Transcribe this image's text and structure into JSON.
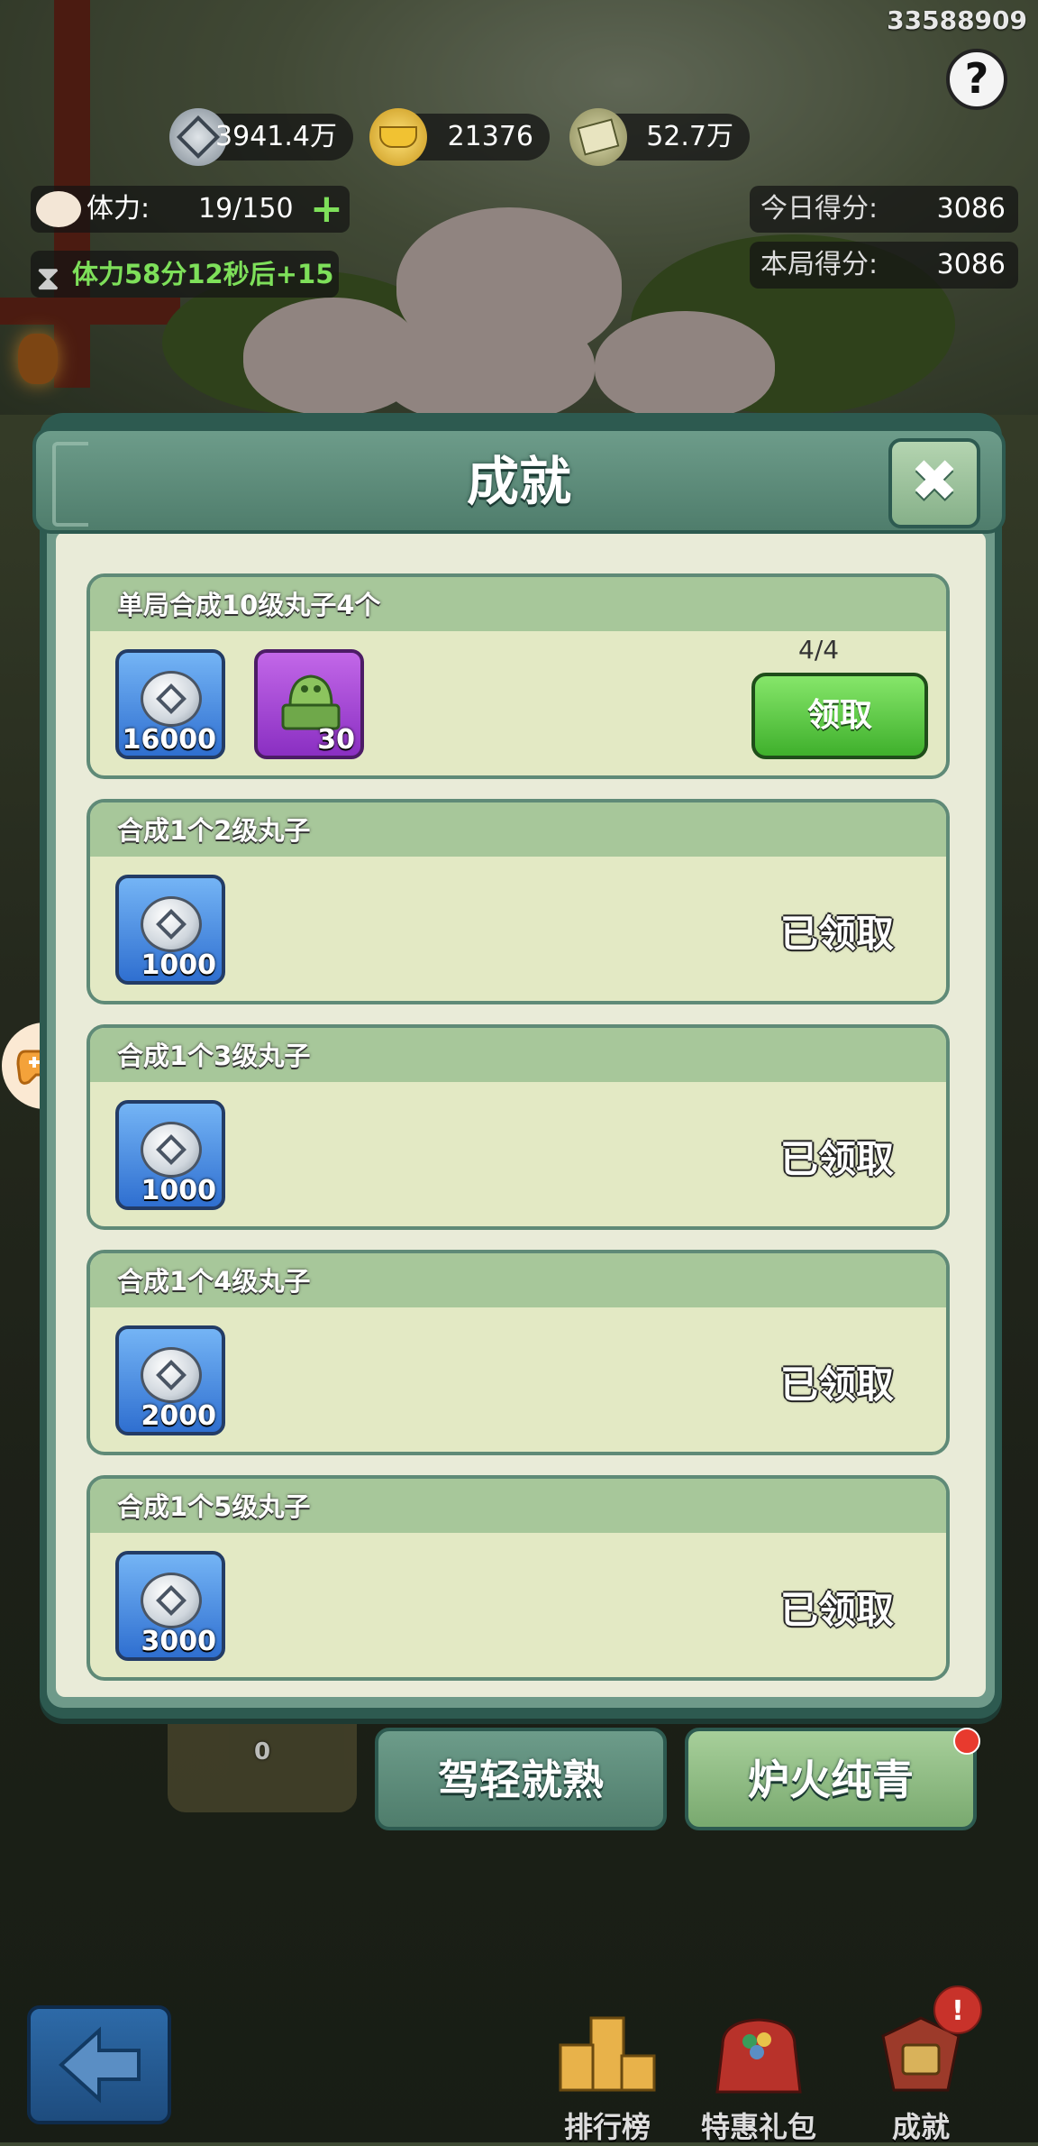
{
  "hud": {
    "user_id": "33588909",
    "help_label": "?",
    "currencies": [
      {
        "icon": "silver-coin-icon",
        "value": "3941.4万"
      },
      {
        "icon": "gold-ingot-icon",
        "value": "21376"
      },
      {
        "icon": "scroll-icon",
        "value": "52.7万"
      }
    ],
    "stamina_label": "体力:",
    "stamina_value": "19/150",
    "stamina_timer": "体力58分12秒后+15",
    "today_score_label": "今日得分:",
    "today_score_value": "3086",
    "round_score_label": "本局得分:",
    "round_score_value": "3086"
  },
  "panel": {
    "title": "成就",
    "close_label": "✖",
    "achievements": [
      {
        "title": "单局合成10级丸子4个",
        "rewards": [
          {
            "icon": "silver-coin-icon",
            "color": "blue",
            "qty": "16000"
          },
          {
            "icon": "jade-seal-icon",
            "color": "purple",
            "qty": "30"
          }
        ],
        "progress": "4/4",
        "claim_label": "领取"
      },
      {
        "title": "合成1个2级丸子",
        "rewards": [
          {
            "icon": "silver-coin-icon",
            "color": "blue",
            "qty": "1000"
          }
        ],
        "status": "已领取"
      },
      {
        "title": "合成1个3级丸子",
        "rewards": [
          {
            "icon": "silver-coin-icon",
            "color": "blue",
            "qty": "1000"
          }
        ],
        "status": "已领取"
      },
      {
        "title": "合成1个4级丸子",
        "rewards": [
          {
            "icon": "silver-coin-icon",
            "color": "blue",
            "qty": "2000"
          }
        ],
        "status": "已领取"
      },
      {
        "title": "合成1个5级丸子",
        "rewards": [
          {
            "icon": "silver-coin-icon",
            "color": "blue",
            "qty": "3000"
          }
        ],
        "status": "已领取"
      }
    ]
  },
  "tabs": [
    {
      "label": "驾轻就熟"
    },
    {
      "label": "炉火纯青"
    }
  ],
  "hidden_item_count": "0",
  "bottom_nav": [
    {
      "icon": "podium-icon",
      "label": "排行榜"
    },
    {
      "icon": "gift-bag-icon",
      "label": "特惠礼包"
    },
    {
      "icon": "achievement-icon",
      "label": "成就"
    }
  ],
  "achievement_badge": "!",
  "colors": {
    "panel_dark": "#2d5a50",
    "card_bg": "#e3e9c4",
    "card_header": "#a7c79a",
    "claim_green": "#3fb02c",
    "reward_blue": "#2f6fd0",
    "reward_purple": "#8a2fc2"
  }
}
